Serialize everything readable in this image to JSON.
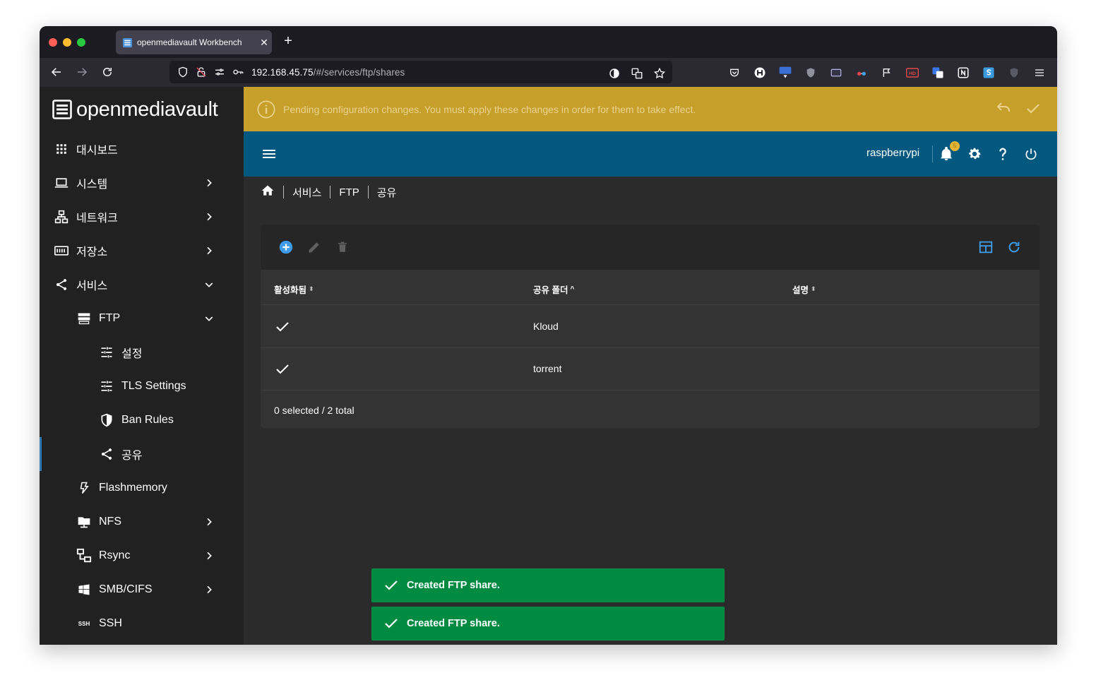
{
  "browser": {
    "tab_title": "openmediavault Workbench",
    "tab_close": "✕",
    "new_tab": "+",
    "url_host": "192.168.45.75",
    "url_path": "/#/services/ftp/shares"
  },
  "app": {
    "brand": "openmediavault",
    "pending_message": "Pending configuration changes. You must apply these changes in order for them to take effect.",
    "username": "raspberrypi",
    "notification_count": "5"
  },
  "sidebar": {
    "items": [
      {
        "label": "대시보드"
      },
      {
        "label": "시스템"
      },
      {
        "label": "네트워크"
      },
      {
        "label": "저장소"
      },
      {
        "label": "서비스"
      },
      {
        "label": "FTP"
      },
      {
        "label": "설정"
      },
      {
        "label": "TLS Settings"
      },
      {
        "label": "Ban Rules"
      },
      {
        "label": "공유"
      },
      {
        "label": "Flashmemory"
      },
      {
        "label": "NFS"
      },
      {
        "label": "Rsync"
      },
      {
        "label": "SMB/CIFS"
      },
      {
        "label": "SSH"
      }
    ],
    "ssh_icon_text": "SSH"
  },
  "breadcrumb": {
    "items": [
      "서비스",
      "FTP",
      "공유"
    ]
  },
  "table": {
    "columns": [
      {
        "label": "활성화됨",
        "sort": "⬍"
      },
      {
        "label": "공유 폴더",
        "sort": "^"
      },
      {
        "label": "설명",
        "sort": "⬍"
      }
    ],
    "rows": [
      {
        "enabled": true,
        "folder": "Kloud",
        "description": ""
      },
      {
        "enabled": true,
        "folder": "torrent",
        "description": ""
      }
    ],
    "footer": "0 selected / 2 total"
  },
  "toasts": [
    {
      "message": "Created FTP share."
    },
    {
      "message": "Created FTP share."
    }
  ],
  "colors": {
    "pending_bg": "#c7a02c",
    "topbar_bg": "#02587e",
    "toast_bg": "#008b43",
    "accent": "#3d9be9"
  }
}
